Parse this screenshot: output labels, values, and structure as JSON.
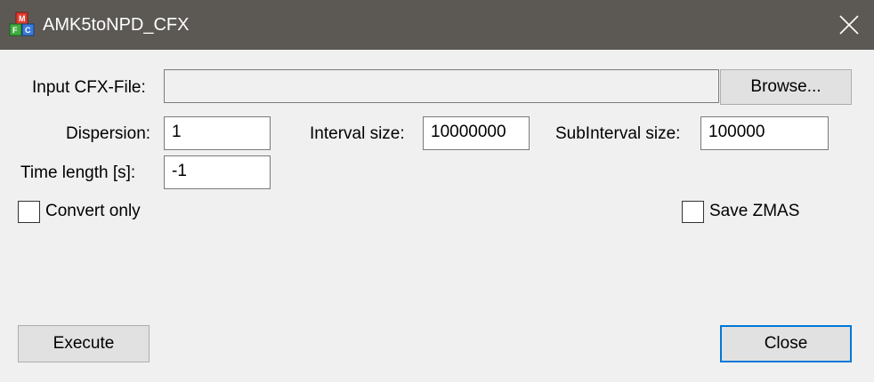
{
  "window": {
    "title": "AMK5toNPD_CFX",
    "app_icon": "app-cubes-icon",
    "close_icon": "close-icon"
  },
  "form": {
    "input_file": {
      "label": "Input CFX-File:",
      "value": ""
    },
    "browse_button": "Browse...",
    "dispersion": {
      "label": "Dispersion:",
      "value": "1"
    },
    "interval_size": {
      "label": "Interval size:",
      "value": "10000000"
    },
    "subinterval_size": {
      "label": "SubInterval size:",
      "value": "100000"
    },
    "time_length": {
      "label": "Time length [s]:",
      "value": "-1"
    },
    "convert_only": {
      "label": "Convert only",
      "checked": false
    },
    "save_zmas": {
      "label": "Save ZMAS",
      "checked": false
    }
  },
  "footer": {
    "execute_button": "Execute",
    "close_button": "Close"
  },
  "colors": {
    "titlebar_bg": "#5c5955",
    "window_bg": "#f0f0f0",
    "accent": "#0078d7"
  }
}
